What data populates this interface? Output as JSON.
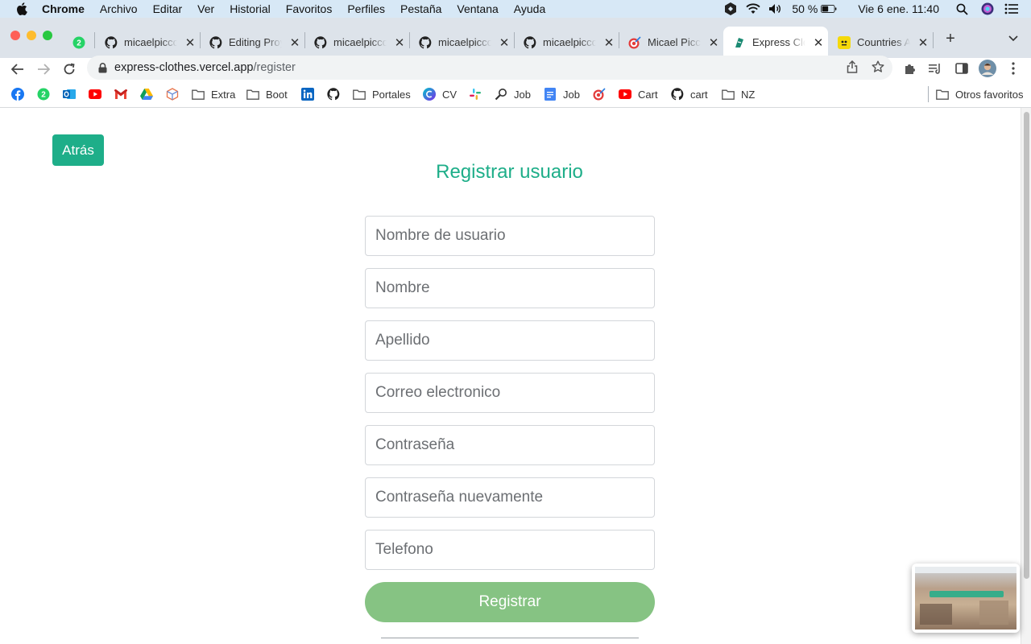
{
  "menubar": {
    "items": [
      "Chrome",
      "Archivo",
      "Editar",
      "Ver",
      "Historial",
      "Favoritos",
      "Perfiles",
      "Pestaña",
      "Ventana",
      "Ayuda"
    ],
    "battery": "50 %",
    "datetime": "Vie 6 ene.  11:40"
  },
  "tabs": [
    {
      "title": "",
      "icon": "badge-icon",
      "badge": "2"
    },
    {
      "title": "micaelpicco",
      "icon": "github-icon"
    },
    {
      "title": "Editing Proy",
      "icon": "github-icon"
    },
    {
      "title": "micaelpicco",
      "icon": "github-icon"
    },
    {
      "title": "micaelpicco",
      "icon": "github-icon"
    },
    {
      "title": "micaelpicco",
      "icon": "github-icon"
    },
    {
      "title": "Micael Picco",
      "icon": "target-icon"
    },
    {
      "title": "Express Clo",
      "icon": "shirt-icon",
      "active": true
    },
    {
      "title": "Countries A",
      "icon": "yellow-app-icon"
    }
  ],
  "toolbar": {
    "url_host": "express-clothes.vercel.app",
    "url_path": "/register"
  },
  "bookmarks": {
    "badge": "2",
    "items": [
      {
        "label": "Extra",
        "icon": "folder-icon"
      },
      {
        "label": "Boot",
        "icon": "folder-icon"
      },
      {
        "label": "Portales",
        "icon": "folder-icon"
      },
      {
        "label": "CV",
        "icon": "cv-icon"
      },
      {
        "label": "Job",
        "icon": "search-job-icon"
      },
      {
        "label": "Job",
        "icon": "docs-icon"
      },
      {
        "label": "Cart",
        "icon": "youtube-icon"
      },
      {
        "label": "cart",
        "icon": "github-icon"
      },
      {
        "label": "NZ",
        "icon": "folder-icon"
      }
    ],
    "other": "Otros favoritos"
  },
  "page": {
    "back_label": "Atrás",
    "title": "Registrar usuario",
    "fields": [
      {
        "placeholder": "Nombre de usuario",
        "value": ""
      },
      {
        "placeholder": "Nombre",
        "value": ""
      },
      {
        "placeholder": "Apellido",
        "value": ""
      },
      {
        "placeholder": "Correo electronico",
        "value": ""
      },
      {
        "placeholder": "Contraseña",
        "value": ""
      },
      {
        "placeholder": "Contraseña nuevamente",
        "value": ""
      },
      {
        "placeholder": "Telefono",
        "value": ""
      }
    ],
    "submit_label": "Registrar"
  },
  "colors": {
    "accent": "#1eae89",
    "submit_button": "#86c383",
    "menubar": "#d7e8f6",
    "tabstrip": "#dde3ea"
  }
}
